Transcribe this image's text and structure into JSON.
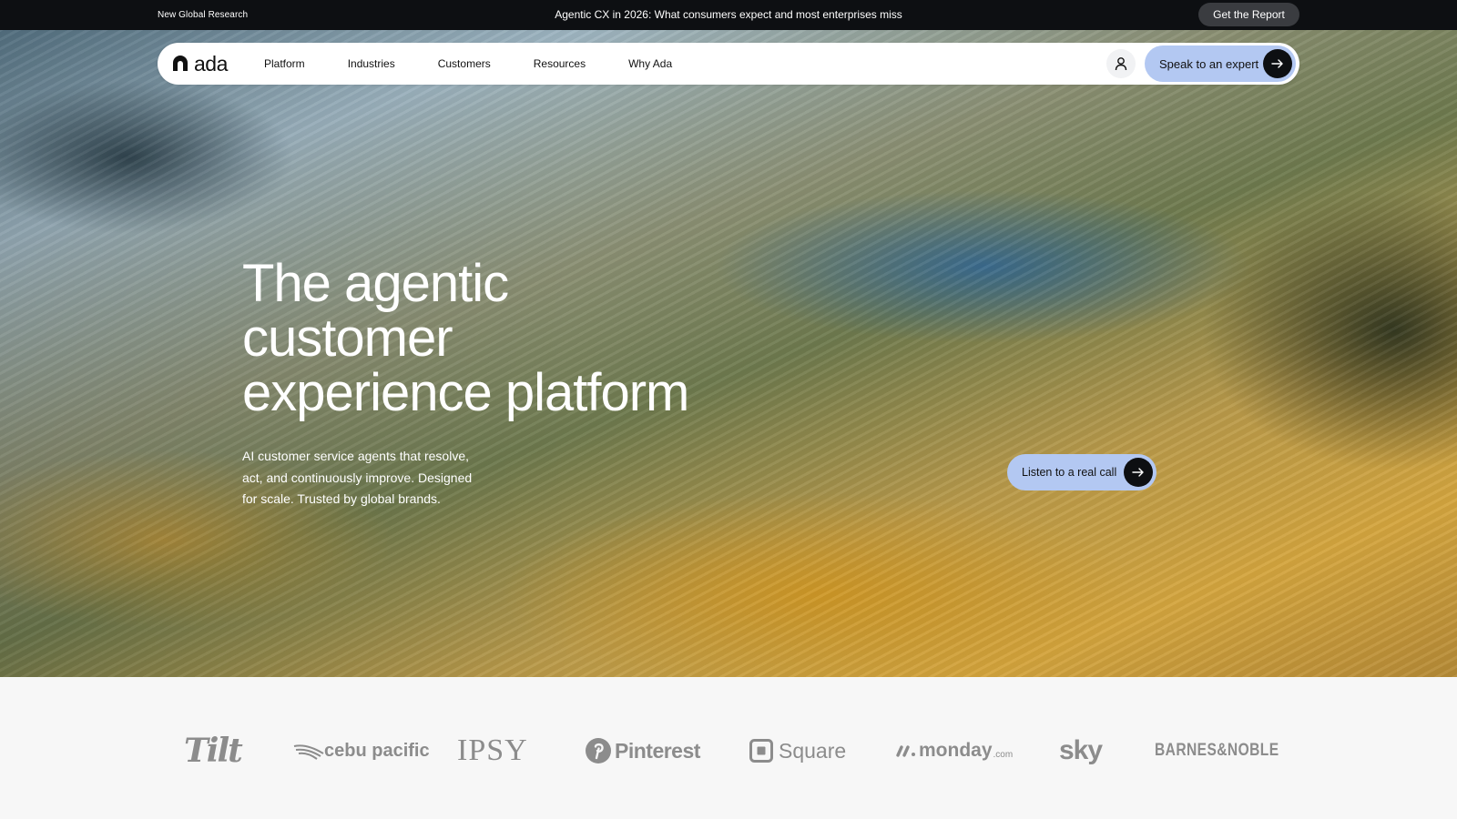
{
  "announcement": {
    "label": "New Global Research",
    "headline": "Agentic CX in 2026: What consumers expect and most enterprises miss",
    "cta": "Get the Report"
  },
  "nav": {
    "brand": "ada",
    "items": [
      {
        "label": "Platform"
      },
      {
        "label": "Industries"
      },
      {
        "label": "Customers"
      },
      {
        "label": "Resources"
      },
      {
        "label": "Why Ada"
      }
    ],
    "cta": "Speak to an expert",
    "icons": {
      "user": "user-icon",
      "arrow": "arrow-right-icon"
    }
  },
  "hero": {
    "headline_lines": [
      "The agentic",
      "customer",
      "experience platform"
    ],
    "subtext": "AI customer service agents that resolve, act, and continuously improve. Designed for scale. Trusted by global brands.",
    "listen_cta": "Listen to a real call"
  },
  "logos": {
    "tilt": "Tilt",
    "cebu": "cebu pacific",
    "ipsy": "IPSY",
    "pinterest": "Pinterest",
    "square": "Square",
    "monday": "monday",
    "monday_suffix": ".com",
    "sky": "sky",
    "barnes": "BARNES&NOBLE"
  },
  "colors": {
    "cta_bg": "#b3c8f2",
    "topbar_bg": "#0d0f12",
    "logo_gray": "#8c8c8c"
  }
}
